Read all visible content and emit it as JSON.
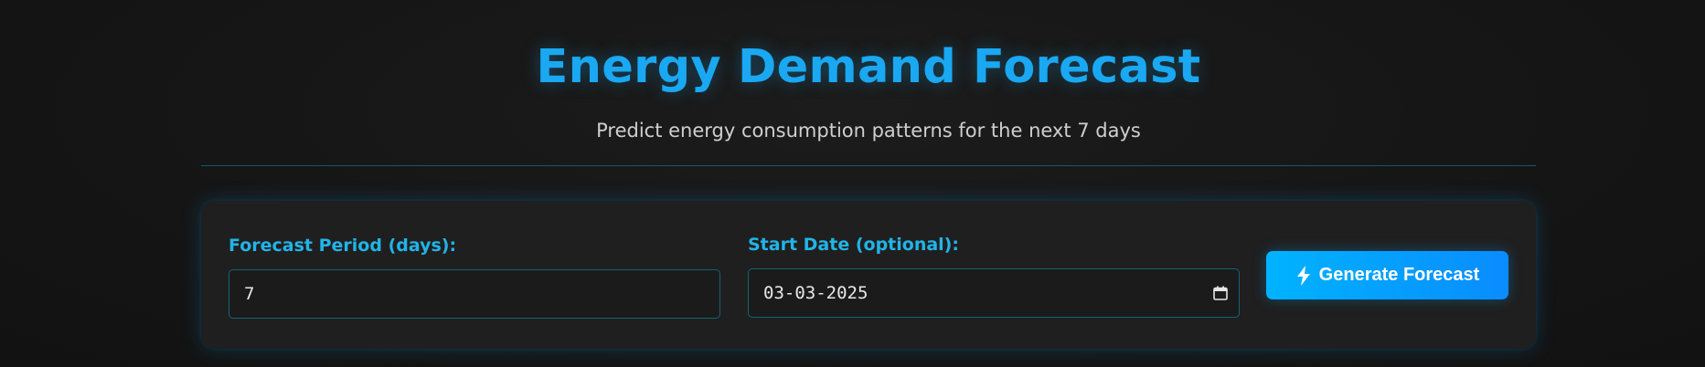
{
  "header": {
    "title": "Energy Demand Forecast",
    "subtitle": "Predict energy consumption patterns for the next 7 days"
  },
  "form": {
    "forecast_period": {
      "label": "Forecast Period (days):",
      "value": "7"
    },
    "start_date": {
      "label": "Start Date (optional):",
      "value": "03-03-2025",
      "icon": "calendar-icon"
    },
    "submit": {
      "label": "Generate Forecast",
      "icon": "lightning-bolt-icon"
    }
  },
  "colors": {
    "accent": "#1aa8f2",
    "button_start": "#00b3ff",
    "button_end": "#0a8cff",
    "background": "#161616",
    "card": "#1f1f1f"
  }
}
